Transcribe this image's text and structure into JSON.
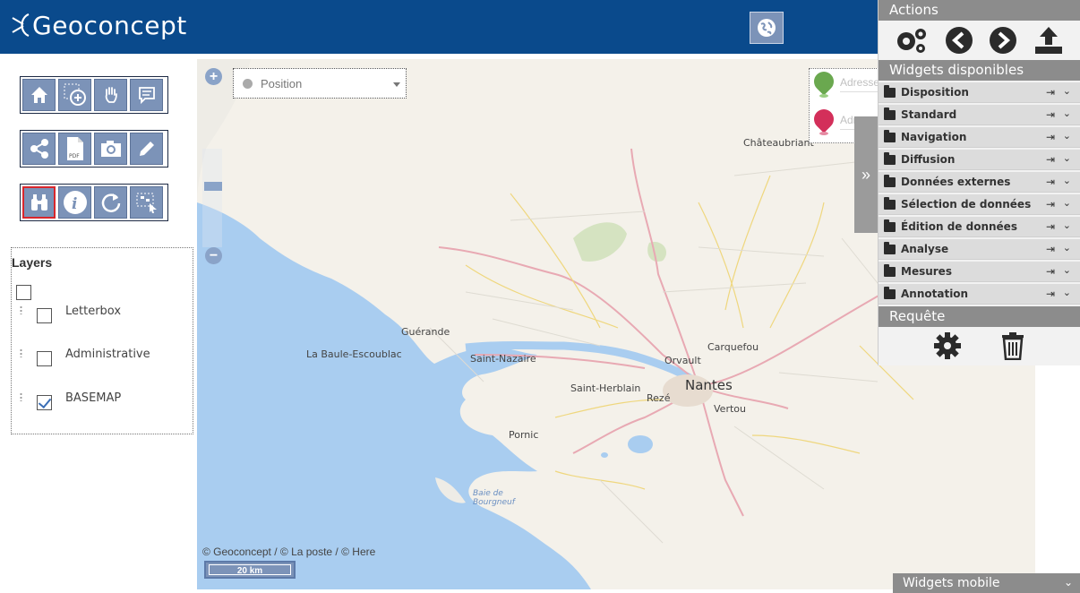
{
  "header": {
    "logo_text": "Geoconcept"
  },
  "toolbar": {
    "row1": [
      "home-icon",
      "zoom-rectangle-icon",
      "pan-hand-icon",
      "tooltip-icon"
    ],
    "row2": [
      "share-icon",
      "pdf-export-icon",
      "camera-icon",
      "pencil-icon"
    ],
    "row3": [
      "binoculars-icon",
      "info-icon",
      "refresh-icon",
      "select-box-icon"
    ],
    "active": "binoculars-icon"
  },
  "layers": {
    "title": "Layers",
    "items": [
      {
        "label": "Letterbox",
        "checked": false
      },
      {
        "label": "Administrative",
        "checked": false
      },
      {
        "label": "BASEMAP",
        "checked": true
      }
    ]
  },
  "map": {
    "position_placeholder": "Position",
    "start_placeholder": "Adresse",
    "end_placeholder": "Adresse",
    "attribution": "© Geoconcept / © La poste / © Here",
    "scale_label": "20 km",
    "labels": {
      "chateaubriant": "Châteaubriant",
      "guerande": "Guérande",
      "labaule": "La Baule-Escoublac",
      "saintnazaire": "Saint-Nazaire",
      "carquefou": "Carquefou",
      "orvault": "Orvault",
      "saintherblain": "Saint-Herblain",
      "nantes": "Nantes",
      "reze": "Rezé",
      "vertou": "Vertou",
      "pornic": "Pornic",
      "baie": "Baie de Bourgneuf"
    }
  },
  "panel": {
    "actions_title": "Actions",
    "widgets_title": "Widgets disponibles",
    "widgets": [
      "Disposition",
      "Standard",
      "Navigation",
      "Diffusion",
      "Données externes",
      "Sélection de données",
      "Édition de données",
      "Analyse",
      "Mesures",
      "Annotation"
    ],
    "request_title": "Requête"
  },
  "mobile": {
    "label": "Widgets mobile"
  },
  "colors": {
    "header": "#0a4a8c",
    "tool": "#7c93b8",
    "panel_header": "#8c8c8c",
    "sea": "#a9cdf0",
    "land": "#f4f1ea"
  }
}
